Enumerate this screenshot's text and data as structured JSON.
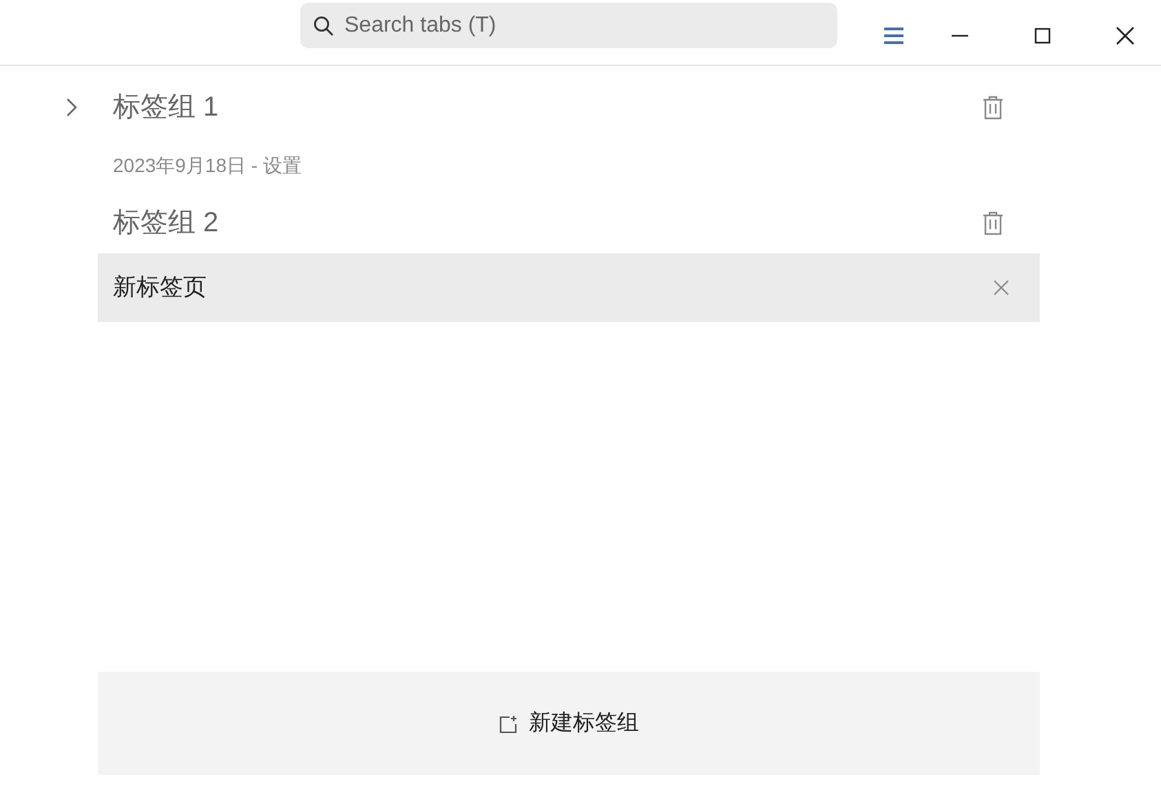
{
  "search": {
    "placeholder": "Search tabs (T)"
  },
  "groups": [
    {
      "title": "标签组 1",
      "expanded": false,
      "subtitle": "2023年9月18日 - 设置"
    },
    {
      "title": "标签组 2",
      "expanded": true,
      "tabs": [
        {
          "title": "新标签页",
          "selected": true
        }
      ]
    }
  ],
  "new_group_button": "新建标签组"
}
